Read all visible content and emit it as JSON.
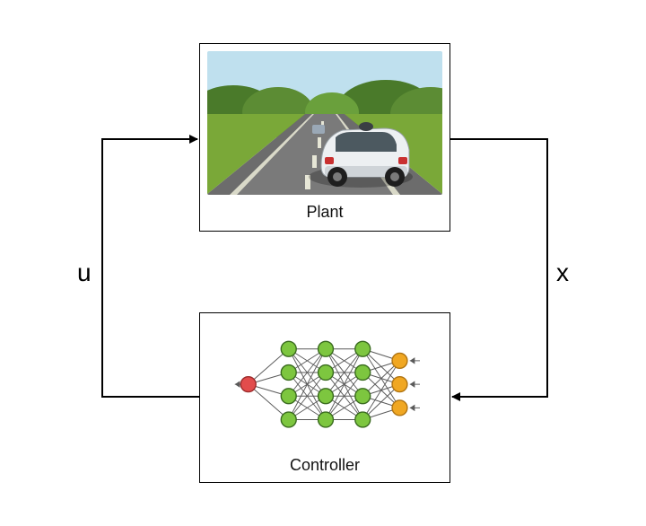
{
  "diagram": {
    "plant_label": "Plant",
    "controller_label": "Controller",
    "signal_u": "u",
    "signal_x": "x"
  },
  "nn": {
    "layers": [
      1,
      4,
      4,
      4,
      3
    ],
    "input_color": "#e24c4c",
    "hidden_color": "#7dc63f",
    "output_color": "#f0a722"
  }
}
